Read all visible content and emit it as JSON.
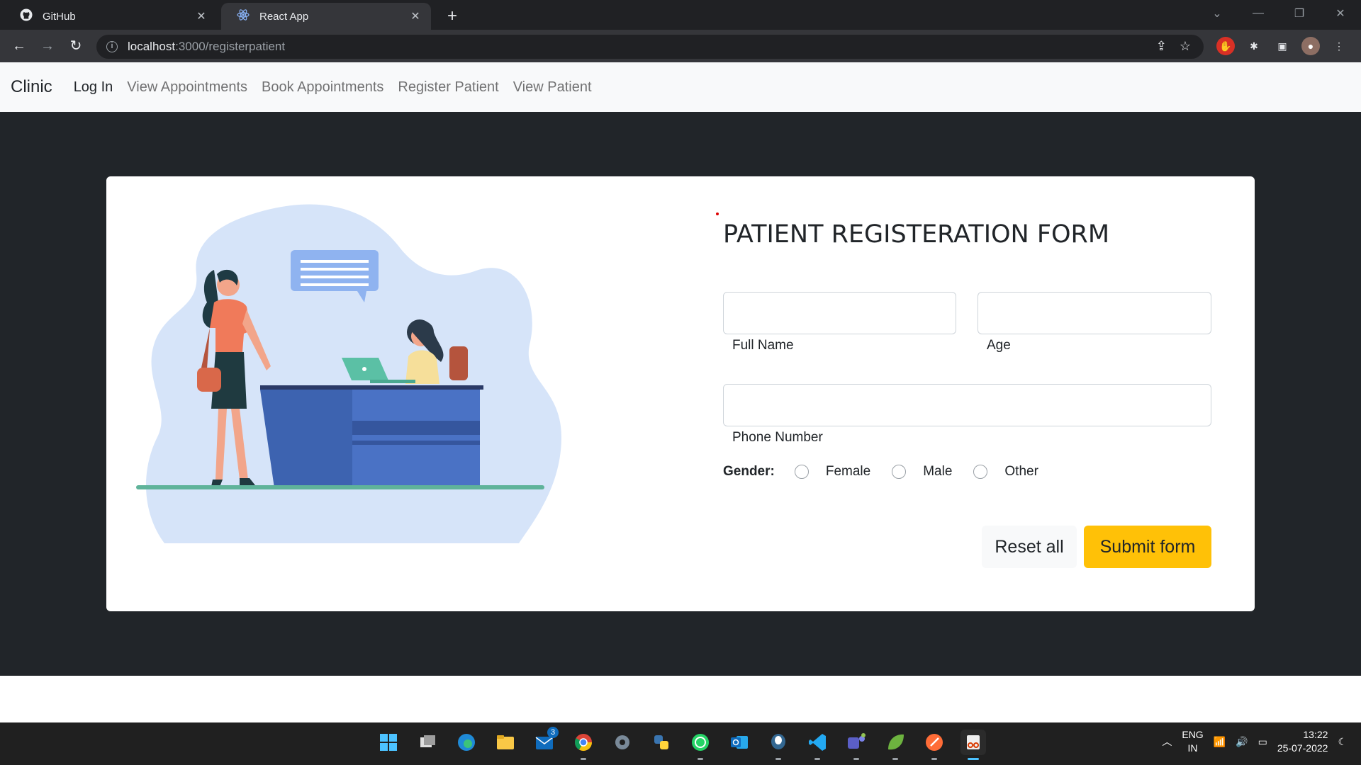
{
  "browser": {
    "tabs": [
      {
        "title": "GitHub",
        "icon": "github-icon",
        "active": false
      },
      {
        "title": "React App",
        "icon": "react-icon",
        "active": true
      }
    ],
    "close_glyph": "✕",
    "new_tab_glyph": "+",
    "url_host": "localhost",
    "url_path": ":3000/registerpatient"
  },
  "navbar": {
    "brand": "Clinic",
    "links": [
      "Log In",
      "View Appointments",
      "Book Appointments",
      "Register Patient",
      "View Patient"
    ]
  },
  "form": {
    "title": "PATIENT REGISTERATION FORM",
    "full_name_label": "Full Name",
    "age_label": "Age",
    "phone_label": "Phone Number",
    "gender_label": "Gender:",
    "gender_options": [
      "Female",
      "Male",
      "Other"
    ],
    "reset_label": "Reset all",
    "submit_label": "Submit form"
  },
  "taskbar": {
    "mail_badge": "3",
    "language_line1": "ENG",
    "language_line2": "IN",
    "time": "13:22",
    "date": "25-07-2022"
  },
  "colors": {
    "chrome_bg": "#202124",
    "toolbar_bg": "#35363a",
    "navbar_bg": "#f8f9fa",
    "page_bg": "#212529",
    "submit_bg": "#ffc107",
    "taskbar_bg": "#202020"
  }
}
